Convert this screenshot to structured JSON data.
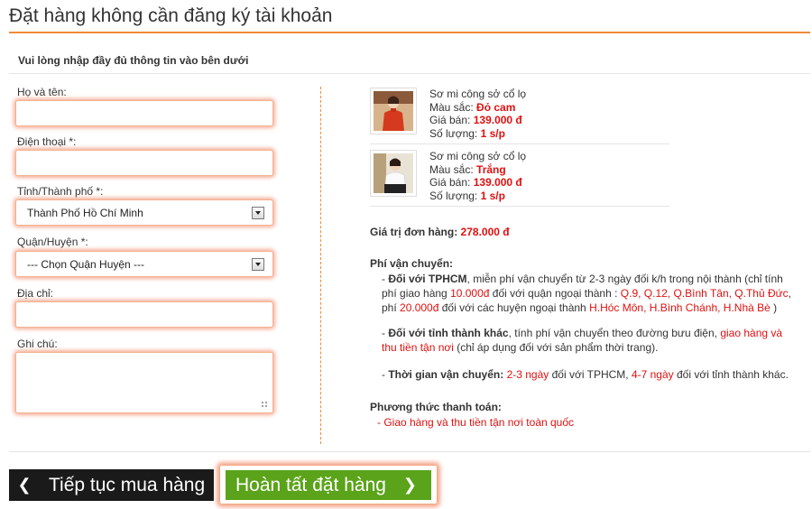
{
  "page": {
    "title": "Đặt hàng không cần đăng ký tài khoản",
    "subtitle": "Vui lòng nhập đầy đủ thông tin vào bên dưới"
  },
  "form": {
    "name_label": "Họ và tên:",
    "name_value": "",
    "phone_label": "Điện thoại *:",
    "phone_value": "",
    "city_label": "Tỉnh/Thành phố *:",
    "city_value": "Thành Phố Hồ Chí Minh",
    "district_label": "Quận/Huyện *:",
    "district_value": "--- Chọn Quận Huyện ---",
    "address_label": "Địa chỉ:",
    "address_value": "",
    "note_label": "Ghi chú:",
    "note_value": ""
  },
  "cart": {
    "items": [
      {
        "name": "Sơ mi công sở cổ lọ",
        "color_label": "Màu sắc:",
        "color_value": "Đỏ cam",
        "price_label": "Giá bán:",
        "price_value": "139.000 đ",
        "qty_label": "Số lượng:",
        "qty_value": "1 s/p"
      },
      {
        "name": "Sơ mi công sở cổ lọ",
        "color_label": "Màu sắc:",
        "color_value": "Trắng",
        "price_label": "Giá bán:",
        "price_value": "139.000 đ",
        "qty_label": "Số lượng:",
        "qty_value": "1 s/p"
      }
    ],
    "total_label": "Giá trị đơn hàng:",
    "total_value": "278.000 đ"
  },
  "shipping": {
    "title": "Phí vận chuyển:",
    "hcm": {
      "prefix": "- ",
      "heading": "Đối với TPHCM",
      "t1": ", miễn phí vận chuyển từ 2-3 ngày đối k/h trong nội thành (chỉ tính phí giao hàng ",
      "fee1": "10.000đ",
      "t2": " đối với quận ngoại thành : ",
      "districts1": "Q.9, Q.12, Q.Bình Tân, Q.Thủ Đức",
      "t3": ", phí ",
      "fee2": "20.000đ",
      "t4": " đối với các huyện ngoại thành ",
      "districts2": "H.Hóc Môn, H.Bình Chánh, H.Nhà Bè",
      "t5": " )"
    },
    "other": {
      "prefix": "- ",
      "heading": "Đối với tỉnh thành khác",
      "t1": ", tính phí vận chuyển theo đường bưu điện, ",
      "cod": "giao hàng và thu tiền tận nơi",
      "t2": " (chỉ áp dụng đối với sản phẩm thời trang)."
    },
    "time": {
      "prefix": "- ",
      "heading": "Thời gian vận chuyển:",
      "days1": "2-3 ngày",
      "t1": " đối với TPHCM, ",
      "days2": "4-7 ngày",
      "t2": " đối với tỉnh thành khác."
    }
  },
  "payment": {
    "title": "Phương thức thanh toán:",
    "method": "- Giao hàng và thu tiền tận nơi toàn quốc"
  },
  "buttons": {
    "back_chevron": "❮",
    "back_label": "Tiếp tục mua hàng",
    "done_label": "Hoàn tất đặt hàng",
    "done_chevron": "❯"
  },
  "colors": {
    "accent_orange": "#f08a3a",
    "price_red": "#e01010",
    "done_green": "#5aa31a",
    "back_black": "#1a1a1a"
  },
  "icons": {
    "select_arrow": "chevron-down-icon",
    "resize": "resize-grip-icon"
  }
}
